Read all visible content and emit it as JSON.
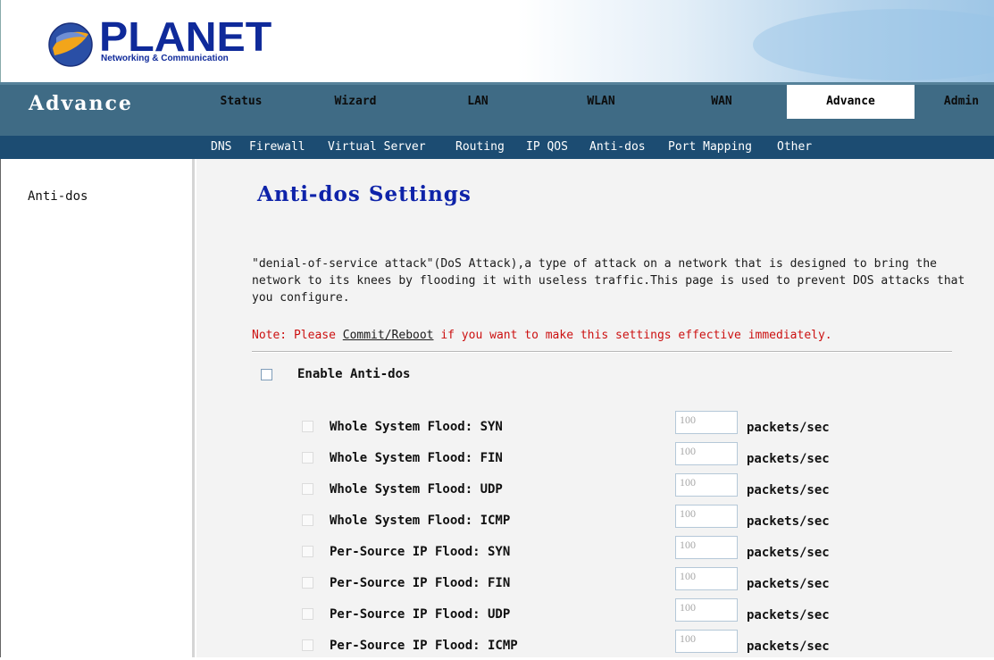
{
  "header": {
    "brand": "PLANET",
    "tagline": "Networking & Communication"
  },
  "nav": {
    "section": "Advance",
    "tabs": [
      {
        "label": "Status"
      },
      {
        "label": "Wizard"
      },
      {
        "label": "LAN"
      },
      {
        "label": "WLAN"
      },
      {
        "label": "WAN"
      },
      {
        "label": "Advance",
        "active": true
      },
      {
        "label": "Admin"
      }
    ],
    "sub": [
      "DNS",
      "Firewall",
      "Virtual Server",
      "Routing",
      "IP QOS",
      "Anti-dos",
      "Port Mapping",
      "Other"
    ]
  },
  "sidebar": {
    "items": [
      "Anti-dos"
    ]
  },
  "main": {
    "title": "Anti-dos Settings",
    "description": "\"denial-of-service attack\"(DoS Attack),a type of attack on a network that is designed to bring the network to its knees by flooding it with useless traffic.This page is used to prevent DOS attacks that you configure.",
    "note_prefix": "Note: Please ",
    "note_link": "Commit/Reboot",
    "note_suffix": " if you want to make this settings effective immediately.",
    "enable_label": "Enable Anti-dos",
    "enable_checked": false,
    "floods": [
      {
        "label": "Whole System Flood: SYN",
        "value": "100",
        "unit": "packets/sec"
      },
      {
        "label": "Whole System Flood: FIN",
        "value": "100",
        "unit": "packets/sec"
      },
      {
        "label": "Whole System Flood: UDP",
        "value": "100",
        "unit": "packets/sec"
      },
      {
        "label": "Whole System Flood: ICMP",
        "value": "100",
        "unit": "packets/sec"
      },
      {
        "label": "Per-Source IP Flood: SYN",
        "value": "100",
        "unit": "packets/sec"
      },
      {
        "label": "Per-Source IP Flood: FIN",
        "value": "100",
        "unit": "packets/sec"
      },
      {
        "label": "Per-Source IP Flood: UDP",
        "value": "100",
        "unit": "packets/sec"
      },
      {
        "label": "Per-Source IP Flood: ICMP",
        "value": "100",
        "unit": "packets/sec"
      }
    ]
  }
}
